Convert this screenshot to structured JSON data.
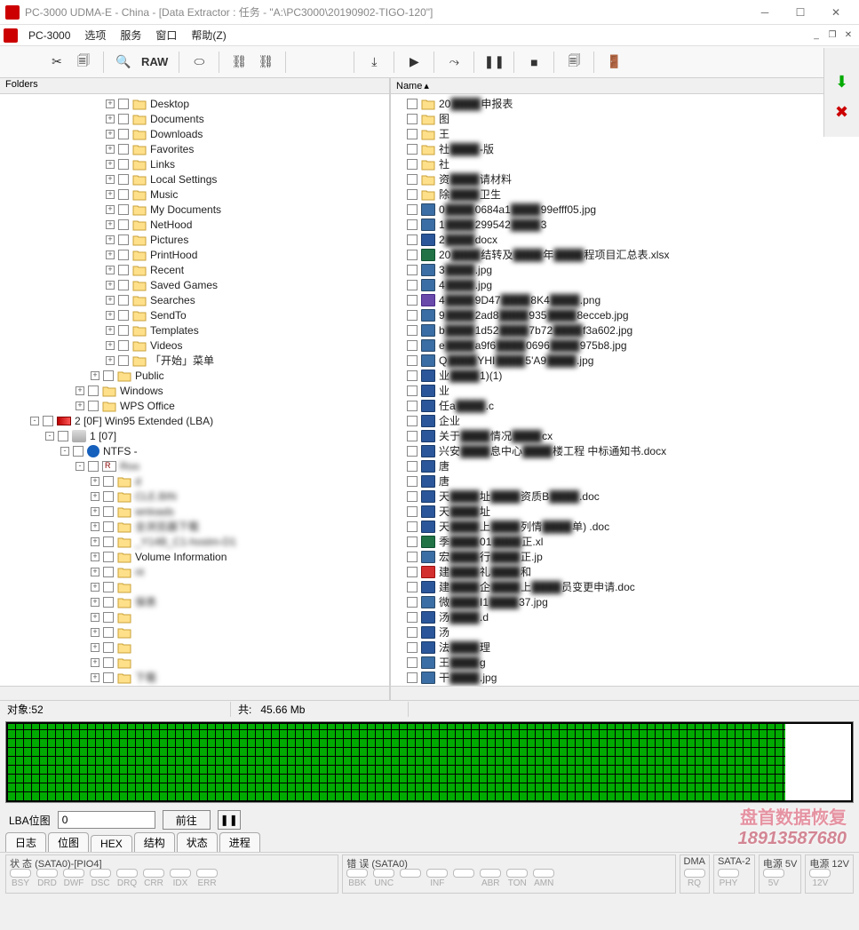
{
  "window": {
    "title": "PC-3000 UDMA-E - China - [Data Extractor : 任务 - \"A:\\PC3000\\20190902-TIGO-120\"]"
  },
  "menubar": {
    "app": "PC-3000",
    "items": [
      "选项",
      "服务",
      "窗口",
      "帮助(Z)"
    ]
  },
  "toolbar": {
    "raw": "RAW"
  },
  "leftPanel": {
    "header": "Folders",
    "tree": [
      {
        "depth": 7,
        "exp": "+",
        "label": "Desktop"
      },
      {
        "depth": 7,
        "exp": "+",
        "label": "Documents"
      },
      {
        "depth": 7,
        "exp": "+",
        "label": "Downloads"
      },
      {
        "depth": 7,
        "exp": "+",
        "label": "Favorites"
      },
      {
        "depth": 7,
        "exp": "+",
        "label": "Links"
      },
      {
        "depth": 7,
        "exp": "+",
        "label": "Local Settings"
      },
      {
        "depth": 7,
        "exp": "+",
        "label": "Music"
      },
      {
        "depth": 7,
        "exp": "+",
        "label": "My Documents"
      },
      {
        "depth": 7,
        "exp": "+",
        "label": "NetHood"
      },
      {
        "depth": 7,
        "exp": "+",
        "label": "Pictures"
      },
      {
        "depth": 7,
        "exp": "+",
        "label": "PrintHood"
      },
      {
        "depth": 7,
        "exp": "+",
        "label": "Recent"
      },
      {
        "depth": 7,
        "exp": "+",
        "label": "Saved Games"
      },
      {
        "depth": 7,
        "exp": "+",
        "label": "Searches"
      },
      {
        "depth": 7,
        "exp": "+",
        "label": "SendTo"
      },
      {
        "depth": 7,
        "exp": "+",
        "label": "Templates"
      },
      {
        "depth": 7,
        "exp": "+",
        "label": "Videos"
      },
      {
        "depth": 7,
        "exp": "+",
        "label": "「开始」菜单"
      },
      {
        "depth": 6,
        "exp": "+",
        "label": "Public"
      },
      {
        "depth": 5,
        "exp": "+",
        "label": "Windows"
      },
      {
        "depth": 5,
        "exp": "+",
        "label": "WPS Office"
      },
      {
        "depth": 2,
        "exp": "-",
        "label": "2 [0F] Win95 Extended  (LBA)",
        "ico": "part"
      },
      {
        "depth": 3,
        "exp": "-",
        "label": "1 [07]",
        "ico": "drive"
      },
      {
        "depth": 4,
        "exp": "-",
        "label": "NTFS -",
        "ico": "ntfs",
        "blurafter": true
      },
      {
        "depth": 5,
        "exp": "-",
        "label": "Roo",
        "ico": "vol",
        "blur": true
      },
      {
        "depth": 6,
        "exp": "+",
        "label": "d",
        "blur": true
      },
      {
        "depth": 6,
        "exp": "+",
        "label": "CLE.BIN",
        "blur": true
      },
      {
        "depth": 6,
        "exp": "+",
        "label": "wnloads",
        "blur": true
      },
      {
        "depth": 6,
        "exp": "+",
        "label": "全浏览器下载",
        "blur": true
      },
      {
        "depth": 6,
        "exp": "+",
        "label": "_Y14B_C1-hostm-D1",
        "blur": true
      },
      {
        "depth": 6,
        "exp": "+",
        "label": "Volume Information"
      },
      {
        "depth": 6,
        "exp": "+",
        "label": "nt",
        "blur": true
      },
      {
        "depth": 6,
        "exp": "+",
        "label": "",
        "blur": true
      },
      {
        "depth": 6,
        "exp": "+",
        "label": "保表",
        "blur": true
      },
      {
        "depth": 6,
        "exp": "+",
        "label": "",
        "blur": true
      },
      {
        "depth": 6,
        "exp": "+",
        "label": "",
        "blur": true
      },
      {
        "depth": 6,
        "exp": "+",
        "label": "",
        "blur": true
      },
      {
        "depth": 6,
        "exp": "+",
        "label": "",
        "blur": true
      },
      {
        "depth": 6,
        "exp": "+",
        "label": "下载",
        "blur": true
      }
    ]
  },
  "rightPanel": {
    "header": "Name",
    "files": [
      {
        "ico": "fold",
        "parts": [
          "20",
          "申报表"
        ],
        "blur": [
          1
        ]
      },
      {
        "ico": "fold",
        "parts": [
          "图"
        ],
        "blur": [
          1
        ]
      },
      {
        "ico": "fold",
        "parts": [
          "王"
        ],
        "blur": [
          1
        ]
      },
      {
        "ico": "fold",
        "parts": [
          "社",
          "-版"
        ],
        "blur": [
          1
        ]
      },
      {
        "ico": "fold",
        "parts": [
          "社"
        ],
        "blur": [
          1
        ]
      },
      {
        "ico": "fold",
        "parts": [
          "资",
          "请材料"
        ],
        "blur": [
          1
        ]
      },
      {
        "ico": "fold",
        "parts": [
          "除",
          "卫生"
        ],
        "blur": [
          1
        ]
      },
      {
        "ico": "jpg",
        "parts": [
          "0",
          "0684a1",
          "99efff05.jpg"
        ],
        "blur": [
          1,
          2
        ]
      },
      {
        "ico": "jpg",
        "parts": [
          "1",
          "299542",
          "3"
        ],
        "blur": [
          1,
          2
        ]
      },
      {
        "ico": "doc",
        "parts": [
          "2",
          "docx"
        ],
        "blur": [
          1
        ]
      },
      {
        "ico": "xls",
        "parts": [
          "20",
          "结转及",
          "年",
          "程项目汇总表.xlsx"
        ],
        "blur": [
          1,
          2,
          3
        ]
      },
      {
        "ico": "jpg",
        "parts": [
          "3",
          ".jpg"
        ],
        "blur": [
          1
        ]
      },
      {
        "ico": "jpg",
        "parts": [
          "4",
          ".jpg"
        ],
        "blur": [
          1
        ]
      },
      {
        "ico": "png",
        "parts": [
          "4",
          "9D47",
          "8K4",
          ".png"
        ],
        "blur": [
          1,
          2,
          3
        ]
      },
      {
        "ico": "jpg",
        "parts": [
          "9",
          "2ad8",
          "935",
          "8ecceb.jpg"
        ],
        "blur": [
          1,
          2,
          3
        ]
      },
      {
        "ico": "jpg",
        "parts": [
          "b",
          "1d52",
          "7b72",
          "f3a602.jpg"
        ],
        "blur": [
          1,
          2,
          3
        ]
      },
      {
        "ico": "jpg",
        "parts": [
          "e",
          "a9f6",
          "0696",
          "975b8.jpg"
        ],
        "blur": [
          1,
          2,
          3
        ]
      },
      {
        "ico": "jpg",
        "parts": [
          "Q",
          "YHI",
          "5'A9",
          ".jpg"
        ],
        "blur": [
          1,
          2,
          3
        ]
      },
      {
        "ico": "doc",
        "parts": [
          "业",
          "1)(1)"
        ],
        "blur": [
          1
        ]
      },
      {
        "ico": "doc",
        "parts": [
          "业"
        ],
        "blur": [
          1
        ]
      },
      {
        "ico": "doc",
        "parts": [
          "任a",
          ".c"
        ],
        "blur": [
          1
        ]
      },
      {
        "ico": "doc",
        "parts": [
          "企业"
        ],
        "blur": [
          1
        ]
      },
      {
        "ico": "doc",
        "parts": [
          "关于",
          "情况",
          "cx"
        ],
        "blur": [
          1,
          2
        ]
      },
      {
        "ico": "doc",
        "parts": [
          "兴安",
          "息中心",
          "楼工程 中标通知书.docx"
        ],
        "blur": [
          1,
          2
        ]
      },
      {
        "ico": "doc",
        "parts": [
          "唐"
        ],
        "blur": [
          1
        ]
      },
      {
        "ico": "doc",
        "parts": [
          "唐"
        ],
        "blur": [
          1
        ]
      },
      {
        "ico": "doc",
        "parts": [
          "天",
          "址",
          "资质B",
          ".doc"
        ],
        "blur": [
          1,
          2,
          3
        ]
      },
      {
        "ico": "doc",
        "parts": [
          "天",
          "址"
        ],
        "blur": [
          1
        ]
      },
      {
        "ico": "doc",
        "parts": [
          "天",
          "上",
          "列情",
          "单) .doc"
        ],
        "blur": [
          1,
          2,
          3
        ]
      },
      {
        "ico": "xls",
        "parts": [
          "季",
          "01",
          "正.xl"
        ],
        "blur": [
          1,
          2
        ]
      },
      {
        "ico": "jpg",
        "parts": [
          "宏",
          "行",
          "正.jp"
        ],
        "blur": [
          1,
          2
        ]
      },
      {
        "ico": "pdf",
        "parts": [
          "建",
          "礼",
          "和"
        ],
        "blur": [
          1,
          2
        ]
      },
      {
        "ico": "doc",
        "parts": [
          "建",
          "企",
          "上",
          "员变更申请.doc"
        ],
        "blur": [
          1,
          2,
          3
        ]
      },
      {
        "ico": "jpg",
        "parts": [
          "微",
          "I1",
          "37.jpg"
        ],
        "blur": [
          1,
          2
        ]
      },
      {
        "ico": "doc",
        "parts": [
          "汤",
          ".d"
        ],
        "blur": [
          1
        ]
      },
      {
        "ico": "doc",
        "parts": [
          "汤"
        ],
        "blur": [
          1
        ]
      },
      {
        "ico": "doc",
        "parts": [
          "法",
          "理"
        ],
        "blur": [
          1
        ]
      },
      {
        "ico": "jpg",
        "parts": [
          "王",
          "g"
        ],
        "blur": [
          1
        ]
      },
      {
        "ico": "jpg",
        "parts": [
          "干",
          ".jpg"
        ],
        "blur": [
          1
        ]
      }
    ]
  },
  "status": {
    "objects_label": "对象:",
    "objects_value": "52",
    "total_label": "共:",
    "total_value": "45.66 Mb"
  },
  "lba": {
    "label": "LBA位图",
    "value": "0",
    "go": "前往",
    "watermark_line1": "盘首数据恢复",
    "watermark_phone": "18913587680"
  },
  "tabs": [
    "日志",
    "位图",
    "HEX",
    "结构",
    "状态",
    "进程"
  ],
  "bottom": {
    "status_label": "状 态 (SATA0)-[PIO4]",
    "status_leds": [
      "BSY",
      "DRD",
      "DWF",
      "DSC",
      "DRQ",
      "CRR",
      "IDX",
      "ERR"
    ],
    "error_label": "错 误 (SATA0)",
    "error_leds": [
      "BBK",
      "UNC",
      "",
      "INF",
      "",
      "ABR",
      "TON",
      "AMN"
    ],
    "dma_label": "DMA",
    "dma_led": "RQ",
    "sata_label": "SATA-2",
    "sata_led": "PHY",
    "p5_label": "电源 5V",
    "p5_led": "5V",
    "p12_label": "电源 12V",
    "p12_led": "12V"
  }
}
